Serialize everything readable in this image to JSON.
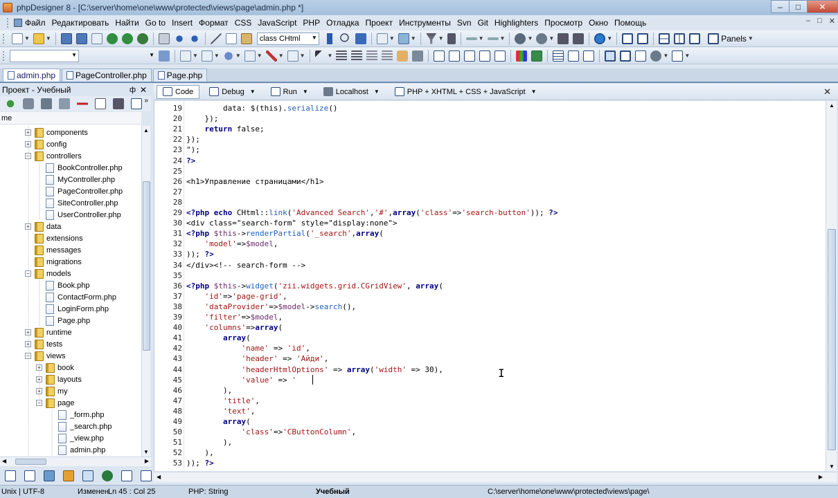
{
  "window": {
    "title": "phpDesigner 8 - [C:\\server\\home\\one\\www\\protected\\views\\page\\admin.php *]",
    "minimize": "–",
    "maximize": "□",
    "close": "✕"
  },
  "menu": {
    "items": [
      "Файл",
      "Редактировать",
      "Найти",
      "Go to",
      "Insert",
      "Формат",
      "CSS",
      "JavaScript",
      "PHP",
      "Отладка",
      "Проект",
      "Инструменты",
      "Svn",
      "Git",
      "Highlighters",
      "Просмотр",
      "Окно",
      "Помощь"
    ],
    "mdi_min": "–",
    "mdi_restore": "□",
    "mdi_close": "✕"
  },
  "toolbar": {
    "class_combo": "class CHtml",
    "panels_label": "Panels"
  },
  "file_tabs": [
    {
      "label": "admin.php",
      "active": true
    },
    {
      "label": "PageController.php",
      "active": false
    },
    {
      "label": "Page.php",
      "active": false
    }
  ],
  "project": {
    "title": "Проект - Учебный",
    "pin": "ф",
    "close": "✕",
    "column_header": "me",
    "tree": [
      {
        "label": "components",
        "type": "folder",
        "level": 1,
        "exp": "+"
      },
      {
        "label": "config",
        "type": "folder",
        "level": 1,
        "exp": "+"
      },
      {
        "label": "controllers",
        "type": "folder",
        "level": 1,
        "exp": "−"
      },
      {
        "label": "BookController.php",
        "type": "file",
        "level": 2,
        "exp": ""
      },
      {
        "label": "MyController.php",
        "type": "file",
        "level": 2,
        "exp": ""
      },
      {
        "label": "PageController.php",
        "type": "file",
        "level": 2,
        "exp": ""
      },
      {
        "label": "SiteController.php",
        "type": "file",
        "level": 2,
        "exp": ""
      },
      {
        "label": "UserController.php",
        "type": "file",
        "level": 2,
        "exp": ""
      },
      {
        "label": "data",
        "type": "folder",
        "level": 1,
        "exp": "+"
      },
      {
        "label": "extensions",
        "type": "folder",
        "level": 1,
        "exp": ""
      },
      {
        "label": "messages",
        "type": "folder",
        "level": 1,
        "exp": ""
      },
      {
        "label": "migrations",
        "type": "folder",
        "level": 1,
        "exp": ""
      },
      {
        "label": "models",
        "type": "folder",
        "level": 1,
        "exp": "−"
      },
      {
        "label": "Book.php",
        "type": "file",
        "level": 2,
        "exp": ""
      },
      {
        "label": "ContactForm.php",
        "type": "file",
        "level": 2,
        "exp": ""
      },
      {
        "label": "LoginForm.php",
        "type": "file",
        "level": 2,
        "exp": ""
      },
      {
        "label": "Page.php",
        "type": "file",
        "level": 2,
        "exp": ""
      },
      {
        "label": "runtime",
        "type": "folder",
        "level": 1,
        "exp": "+"
      },
      {
        "label": "tests",
        "type": "folder",
        "level": 1,
        "exp": "+"
      },
      {
        "label": "views",
        "type": "folder",
        "level": 1,
        "exp": "−"
      },
      {
        "label": "book",
        "type": "folder",
        "level": 2,
        "exp": "+"
      },
      {
        "label": "layouts",
        "type": "folder",
        "level": 2,
        "exp": "+"
      },
      {
        "label": "my",
        "type": "folder",
        "level": 2,
        "exp": "+"
      },
      {
        "label": "page",
        "type": "folder",
        "level": 2,
        "exp": "−"
      },
      {
        "label": "_form.php",
        "type": "file",
        "level": 3,
        "exp": ""
      },
      {
        "label": "_search.php",
        "type": "file",
        "level": 3,
        "exp": ""
      },
      {
        "label": "_view.php",
        "type": "file",
        "level": 3,
        "exp": ""
      },
      {
        "label": "admin.php",
        "type": "file",
        "level": 3,
        "exp": ""
      }
    ]
  },
  "editor_toolbar": {
    "code": "Code",
    "debug": "Debug",
    "run": "Run",
    "localhost": "Localhost",
    "highlighter": "PHP + XHTML + CSS + JavaScript",
    "close": "✕"
  },
  "code_lines": [
    {
      "n": "19",
      "t": "        data: $(this).serialize()"
    },
    {
      "n": "20",
      "t": "    });"
    },
    {
      "n": "21",
      "t": "    return false;"
    },
    {
      "n": "22",
      "t": "});"
    },
    {
      "n": "23",
      "t": "\");"
    },
    {
      "n": "24",
      "t": "?>"
    },
    {
      "n": "25",
      "t": ""
    },
    {
      "n": "26",
      "t": "<h1>Управление страницами</h1>"
    },
    {
      "n": "27",
      "t": ""
    },
    {
      "n": "28",
      "t": ""
    },
    {
      "n": "29",
      "t": "<?php echo CHtml::link('Advanced Search','#',array('class'=>'search-button')); ?>"
    },
    {
      "n": "30",
      "t": "<div class=\"search-form\" style=\"display:none\">"
    },
    {
      "n": "31",
      "t": "<?php $this->renderPartial('_search',array("
    },
    {
      "n": "32",
      "t": "    'model'=>$model,"
    },
    {
      "n": "33",
      "t": ")); ?>"
    },
    {
      "n": "34",
      "t": "</div><!-- search-form -->"
    },
    {
      "n": "35",
      "t": ""
    },
    {
      "n": "36",
      "t": "<?php $this->widget('zii.widgets.grid.CGridView', array("
    },
    {
      "n": "37",
      "t": "    'id'=>'page-grid',"
    },
    {
      "n": "38",
      "t": "    'dataProvider'=>$model->search(),"
    },
    {
      "n": "39",
      "t": "    'filter'=>$model,"
    },
    {
      "n": "40",
      "t": "    'columns'=>array("
    },
    {
      "n": "41",
      "t": "        array("
    },
    {
      "n": "42",
      "t": "            'name' => 'id',"
    },
    {
      "n": "43",
      "t": "            'header' => 'Айди',"
    },
    {
      "n": "44",
      "t": "            'headerHtmlOptions' => array('width' => 30),"
    },
    {
      "n": "45",
      "t": "            'value' => '"
    },
    {
      "n": "46",
      "t": "        ),"
    },
    {
      "n": "47",
      "t": "        'title',"
    },
    {
      "n": "48",
      "t": "        'text',"
    },
    {
      "n": "49",
      "t": "        array("
    },
    {
      "n": "50",
      "t": "            'class'=>'CButtonColumn',"
    },
    {
      "n": "51",
      "t": "        ),"
    },
    {
      "n": "52",
      "t": "    ),"
    },
    {
      "n": "53",
      "t": ")); ?>"
    }
  ],
  "status": {
    "line_endings": "Unix | UTF-8",
    "modified": "Изменен",
    "position": "Ln  45 : Col  25",
    "context": "PHP: String",
    "project": "Учебный",
    "path": "C:\\server\\home\\one\\www\\protected\\views\\page\\"
  }
}
